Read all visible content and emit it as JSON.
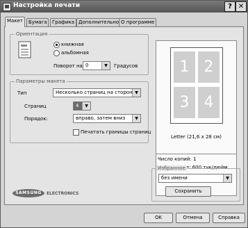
{
  "window": {
    "title": "Настройка печати",
    "help_btn": "?",
    "close_btn": "✕"
  },
  "tabs": [
    "Макет",
    "Бумага",
    "Графика",
    "Дополнительно",
    "О программе"
  ],
  "orientation": {
    "group_title": "Ориентация",
    "portrait_label": "книжная",
    "landscape_label": "альбомная",
    "selected": "portrait",
    "rotate_label": "Поворот на",
    "rotate_value": "0",
    "rotate_unit": "Градусов"
  },
  "layout": {
    "group_title": "Параметры макета",
    "type_label": "Тип",
    "type_value": "Несколько страниц на стороне",
    "pages_label": "Страниц",
    "pages_value": "4",
    "order_label": "Порядок:",
    "order_value": "вправо, затем вниз",
    "borders_label": "Печатать границы страниц"
  },
  "preview": {
    "cells": [
      "1",
      "2",
      "3",
      "4"
    ],
    "paper_label": "Letter (21,6 x 28 см)",
    "copies_label": "Число копий: 1",
    "resolution_label": "Разрешение: 600 тчк/дюйм"
  },
  "favorites": {
    "group_title": "Избранное",
    "value": "без имени",
    "save_button": "Сохранить"
  },
  "brand": {
    "name": "SAMSUNG",
    "sub": "ELECTRONICS"
  },
  "footer": {
    "ok": "OK",
    "cancel": "Отмена",
    "help": "Справка"
  },
  "icons": {
    "app": "printer-icon",
    "orientation": "document-portrait-icon"
  }
}
